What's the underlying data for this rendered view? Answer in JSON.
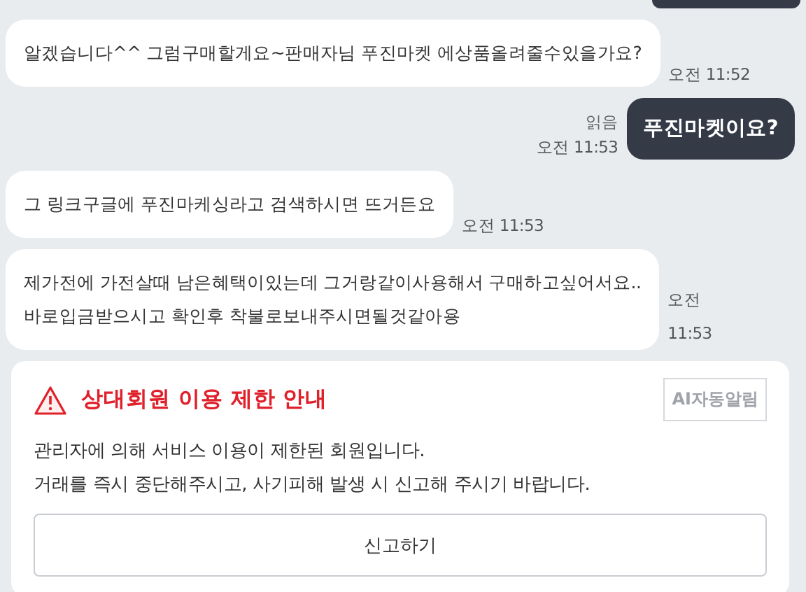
{
  "messages": [
    {
      "kind": "incoming",
      "lines": [
        "알겠습니다^^ 그럼구매할게요~판매자님 푸진마켓 에상품올려줄수있을가요?"
      ],
      "time": "오전 11:52"
    },
    {
      "kind": "outgoing",
      "lines": [
        "푸진마켓이요?"
      ],
      "read_label": "읽음",
      "time": "오전 11:53"
    },
    {
      "kind": "incoming",
      "lines": [
        "그 링크구글에 푸진마케싱라고 검색하시면 뜨거든요"
      ],
      "time": "오전 11:53"
    },
    {
      "kind": "incoming",
      "lines": [
        "제가전에 가전살때 남은혜택이있는데 그거랑같이사용해서 구매하고싶어서요..",
        "바로입금받으시고 확인후 착불로보내주시면될것같아용"
      ],
      "time": "오전 11:53",
      "time_wrapped": true
    }
  ],
  "notice": {
    "title": "상대회원 이용 제한 안내",
    "badge": "AI자동알림",
    "lines": [
      "관리자에 의해 서비스 이용이 제한된 회원입니다.",
      "거래를 즉시 중단해주시고, 사기피해 발생 시 신고해 주시기 바랍니다."
    ],
    "button": "신고하기"
  }
}
